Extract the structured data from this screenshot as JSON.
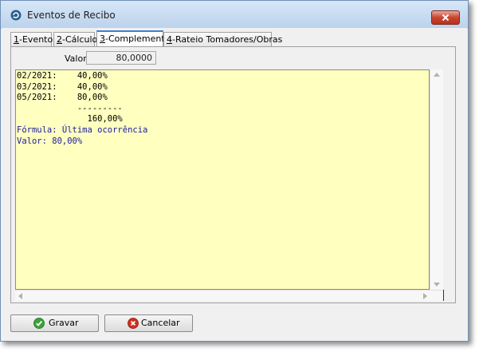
{
  "window": {
    "title": "Eventos de Recibo",
    "title_icon": "refresh-circle-icon",
    "close_icon": "close-icon"
  },
  "tabs": [
    {
      "key": "1",
      "label": "-Evento"
    },
    {
      "key": "2",
      "label": "-Cálculo"
    },
    {
      "key": "3",
      "label": "-Complemento"
    },
    {
      "key": "4",
      "label": "-Rateio Tomadores/Obras"
    }
  ],
  "active_tab": 2,
  "form": {
    "valor_label": "Valor",
    "valor_value": "80,0000"
  },
  "memo": {
    "lines": [
      "02/2021:    40,00%",
      "03/2021:    40,00%",
      "05/2021:    80,00%",
      "            ---------",
      "              160,00%",
      "Fórmula: Última ocorrência",
      "Valor: 80,00%"
    ],
    "text_color": "#000000",
    "formula_color": "#1a1aa0",
    "background": "#ffffc0"
  },
  "buttons": {
    "save": {
      "label": "Gravar",
      "icon": "check-icon",
      "icon_color": "#3aa23a"
    },
    "cancel": {
      "label": "Cancelar",
      "icon": "cancel-x-icon",
      "icon_color": "#d03020"
    }
  }
}
